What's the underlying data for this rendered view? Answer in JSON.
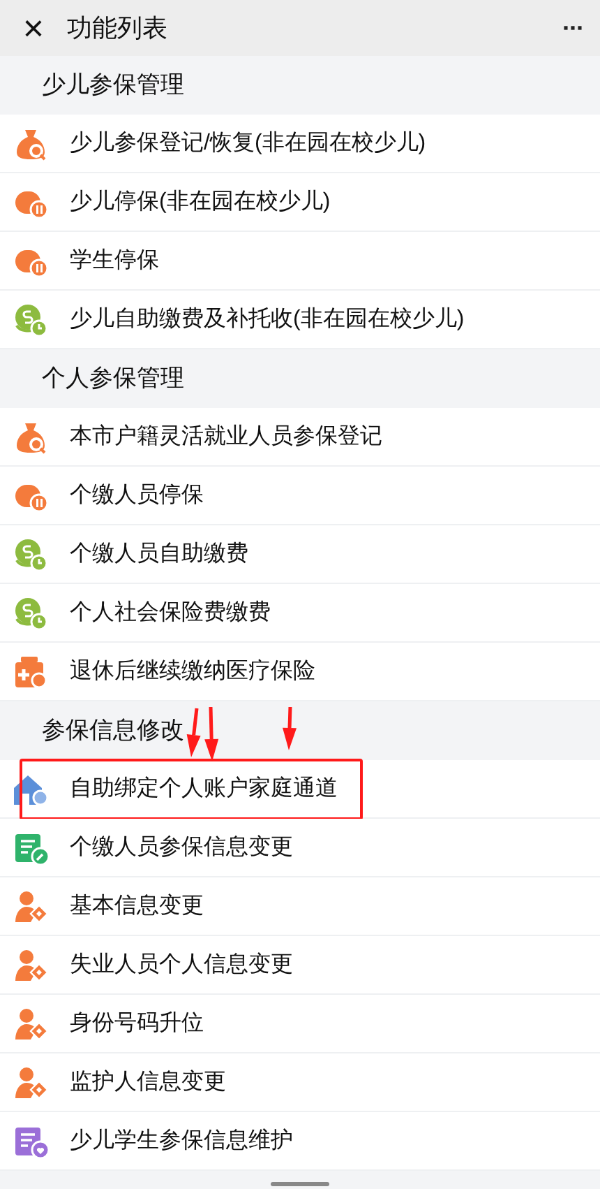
{
  "header": {
    "close": "×",
    "title": "功能列表",
    "more": "···"
  },
  "sections": [
    {
      "title": "少儿参保管理",
      "items": [
        {
          "label": "少儿参保登记/恢复(非在园在校少儿)",
          "kind": "bag",
          "highlighted": false
        },
        {
          "label": "少儿停保(非在园在校少儿)",
          "kind": "pause",
          "highlighted": false
        },
        {
          "label": "学生停保",
          "kind": "pause",
          "highlighted": false
        },
        {
          "label": "少儿自助缴费及补托收(非在园在校少儿)",
          "kind": "coin",
          "highlighted": false
        }
      ]
    },
    {
      "title": "个人参保管理",
      "items": [
        {
          "label": "本市户籍灵活就业人员参保登记",
          "kind": "bag",
          "highlighted": false
        },
        {
          "label": "个缴人员停保",
          "kind": "pause",
          "highlighted": false
        },
        {
          "label": "个缴人员自助缴费",
          "kind": "coin",
          "highlighted": false
        },
        {
          "label": "个人社会保险费缴费",
          "kind": "coin",
          "highlighted": false
        },
        {
          "label": "退休后继续缴纳医疗保险",
          "kind": "medkit",
          "highlighted": false
        }
      ]
    },
    {
      "title": "参保信息修改",
      "items": [
        {
          "label": "自助绑定个人账户家庭通道",
          "kind": "house",
          "highlighted": true
        },
        {
          "label": "个缴人员参保信息变更",
          "kind": "form",
          "highlighted": false
        },
        {
          "label": "基本信息变更",
          "kind": "person",
          "highlighted": false
        },
        {
          "label": "失业人员个人信息变更",
          "kind": "person",
          "highlighted": false
        },
        {
          "label": "身份号码升位",
          "kind": "person",
          "highlighted": false
        },
        {
          "label": "监护人信息变更",
          "kind": "person",
          "highlighted": false
        },
        {
          "label": "少儿学生参保信息维护",
          "kind": "purpleform",
          "highlighted": false
        }
      ]
    }
  ]
}
